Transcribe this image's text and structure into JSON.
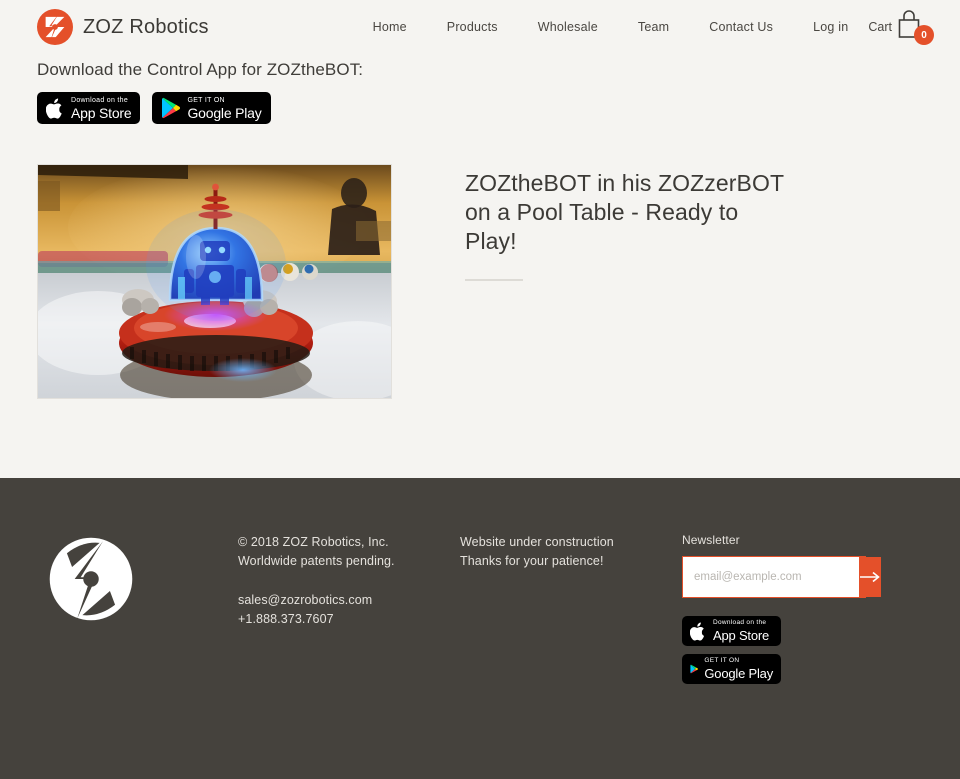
{
  "header": {
    "brand_name": "ZOZ Robotics",
    "logo_icon": "zoz-circular-z-logo",
    "nav": [
      {
        "label": "Home"
      },
      {
        "label": "Products"
      },
      {
        "label": "Wholesale"
      },
      {
        "label": "Team"
      },
      {
        "label": "Contact Us"
      },
      {
        "label": "Log in"
      }
    ],
    "cart": {
      "label": "Cart",
      "icon": "shopping-bag-icon",
      "count": "0",
      "badge_color": "#e4502a"
    }
  },
  "app_strip": {
    "title": "Download the Control App for ZOZtheBOT:",
    "app_store": {
      "top": "Download on the",
      "bottom": "App Store",
      "icon": "apple-icon"
    },
    "google_play": {
      "top": "GET IT ON",
      "bottom": "Google Play",
      "icon": "google-play-icon"
    }
  },
  "feature": {
    "image_alt": "ZOZtheBOT robot with glowing blue dome on a red ZOZzerBOT saucer, sitting on a pool table",
    "title": "ZOZtheBOT in his ZOZzerBOT on a Pool Table - Ready to Play!"
  },
  "footer": {
    "logo_icon": "zoz-circular-z-logo-white",
    "column_a": {
      "line1": "© 2018 ZOZ Robotics, Inc.",
      "line2": "Worldwide patents pending.",
      "email": "sales@zozrobotics.com",
      "phone": "+1.888.373.7607"
    },
    "column_b": {
      "line1": "Website under construction",
      "line2": "Thanks for your patience!"
    },
    "newsletter": {
      "label": "Newsletter",
      "placeholder": "email@example.com",
      "value": "",
      "submit_icon": "arrow-right-icon",
      "accent_color": "#e4502a"
    },
    "app_store": {
      "top": "Download on the",
      "bottom": "App Store",
      "icon": "apple-icon"
    },
    "google_play": {
      "top": "GET IT ON",
      "bottom": "Google Play",
      "icon": "google-play-icon"
    }
  },
  "theme": {
    "page_background": "#f5f4f1",
    "footer_background": "#45423d",
    "accent": "#e4502a",
    "text": "#3f3d39"
  }
}
